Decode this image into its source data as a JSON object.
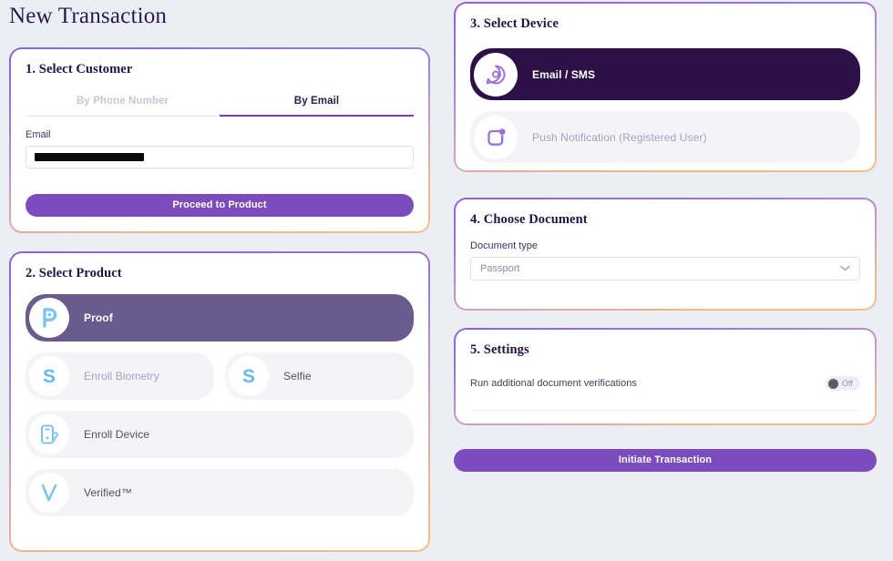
{
  "page": {
    "title": "New Transaction"
  },
  "customer": {
    "heading": "1. Select Customer",
    "tabs": [
      {
        "label": "By Phone Number",
        "active": false
      },
      {
        "label": "By Email",
        "active": true
      }
    ],
    "email_label": "Email",
    "email_value": "",
    "email_redacted": true,
    "proceed_label": "Proceed to Product"
  },
  "product": {
    "heading": "2. Select Product",
    "items": [
      {
        "label": "Proof",
        "icon": "proof-p-icon",
        "selected": true
      },
      {
        "label": "Enroll Biometry",
        "icon": "biometry-s-icon",
        "selected": false,
        "muted": true
      },
      {
        "label": "Selfie",
        "icon": "selfie-s-icon",
        "selected": false
      },
      {
        "label": "Enroll Device",
        "icon": "enroll-device-phone-icon",
        "selected": false
      },
      {
        "label": "Verified™",
        "icon": "verified-check-icon",
        "selected": false
      }
    ]
  },
  "device": {
    "heading": "3. Select Device",
    "items": [
      {
        "label": "Email / SMS",
        "icon": "email-sms-chat-icon",
        "selected": true
      },
      {
        "label": "Push Notification (Registered User)",
        "icon": "push-notification-icon",
        "selected": false,
        "muted": true
      }
    ]
  },
  "document": {
    "heading": "4. Choose Document",
    "type_label": "Document type",
    "type_value": "Passport",
    "chevron": "chevron-down-icon"
  },
  "settings": {
    "heading": "5. Settings",
    "rows": [
      {
        "label": "Run additional document verifications",
        "state": "Off",
        "on": false
      }
    ]
  },
  "footer": {
    "initiate_label": "Initiate Transaction"
  },
  "colors": {
    "accent_purple": "#7c4cbd",
    "dark_purple": "#2b1146",
    "selected_product": "#6b5a8e",
    "icon_blue": "#7ec5ee",
    "icon_purple": "#9b72d6",
    "page_bg": "#eceef5"
  }
}
